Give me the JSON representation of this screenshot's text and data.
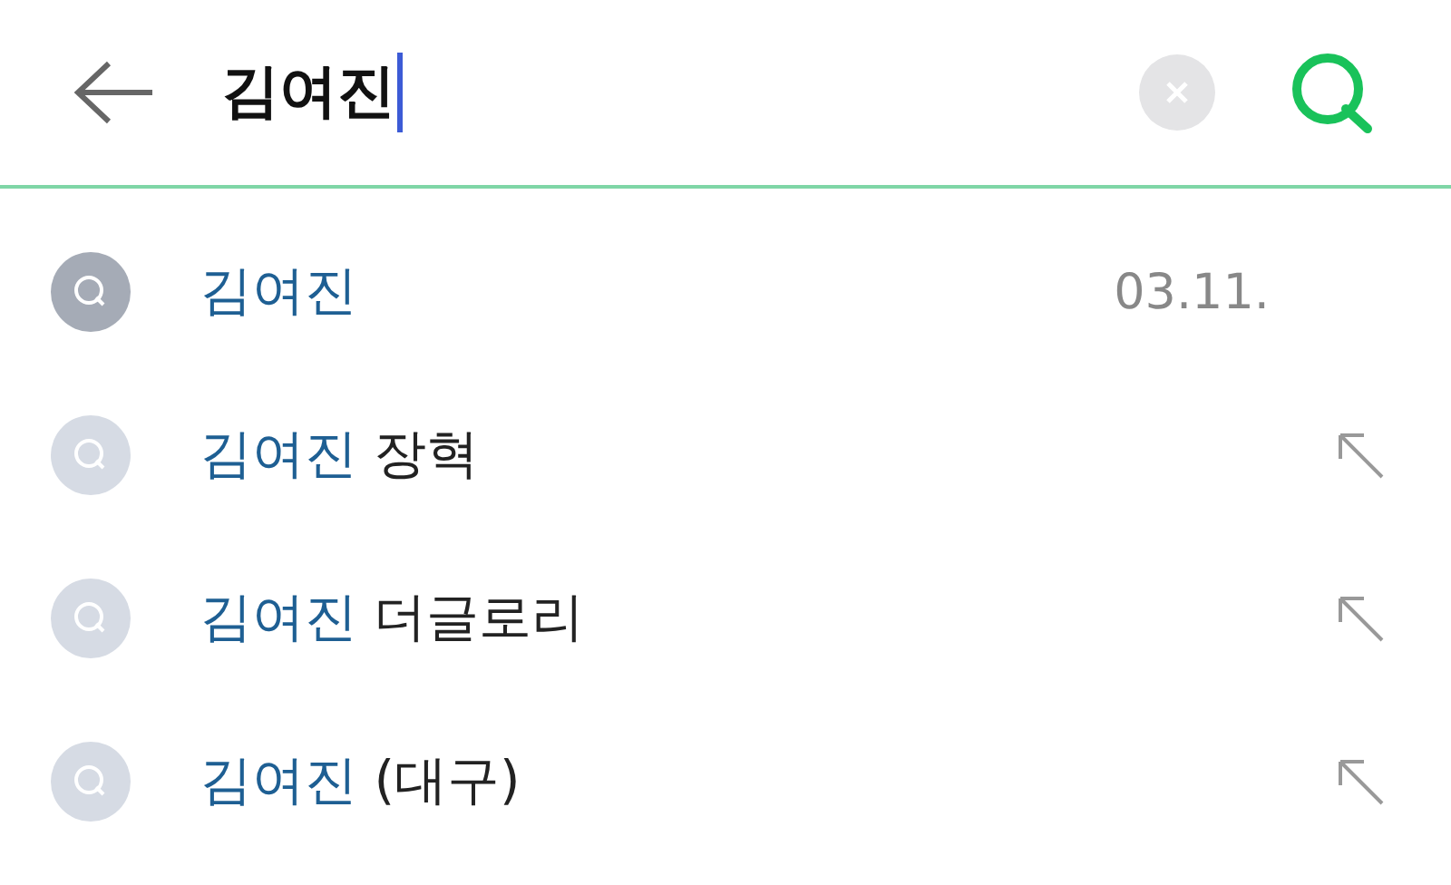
{
  "search": {
    "value": "김여진"
  },
  "results": [
    {
      "kind": "history",
      "match": "김여진",
      "date": "03.11."
    },
    {
      "kind": "suggestion",
      "match": "김여진",
      "rest": "장혁"
    },
    {
      "kind": "suggestion",
      "match": "김여진",
      "rest": "더글로리"
    },
    {
      "kind": "suggestion",
      "match": "김여진",
      "rest": "(대구)"
    }
  ]
}
